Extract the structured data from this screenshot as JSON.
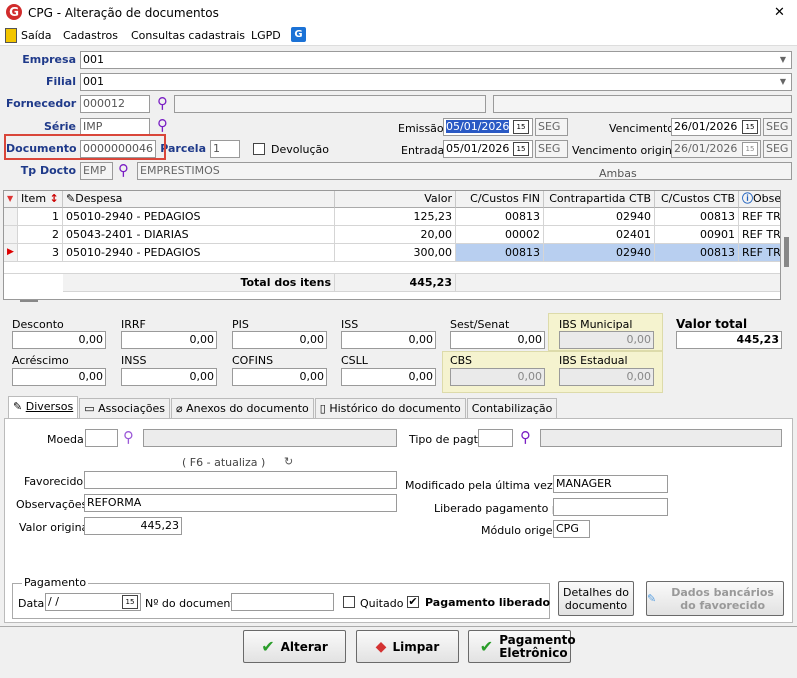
{
  "window": {
    "title": "CPG - Alteração de documentos",
    "close_glyph": "✕"
  },
  "menu": {
    "items": [
      "Saída",
      "Cadastros",
      "Consultas cadastrais",
      "LGPD"
    ]
  },
  "header": {
    "empresa_label": "Empresa",
    "empresa_value": "001",
    "filial_label": "Filial",
    "filial_value": "001",
    "fornecedor_label": "Fornecedor",
    "fornecedor_value": "000012",
    "serie_label": "Série",
    "serie_value": "IMP",
    "documento_label": "Documento",
    "documento_value": "0000000046",
    "parcela_label": "Parcela",
    "parcela_value": "1",
    "devolucao_label": "Devolução",
    "tpdocto_label": "Tp Docto",
    "tpdocto_code": "EMP",
    "tpdocto_desc": "EMPRESTIMOS",
    "emissao_label": "Emissão",
    "emissao_value": "05/01/2026",
    "emissao_day": "SEG",
    "entrada_label": "Entrada",
    "entrada_value": "05/01/2026",
    "entrada_day": "SEG",
    "vencimento_label": "Vencimento",
    "vencimento_value": "26/01/2026",
    "vencimento_day": "SEG",
    "venc_original_label": "Vencimento original",
    "venc_original_value": "26/01/2026",
    "venc_original_day": "SEG",
    "ambas_label": "Ambas",
    "cal_glyph": "15"
  },
  "items_grid": {
    "columns": [
      "Item",
      "Despesa",
      "Valor",
      "C/Custos FIN",
      "Contrapartida CTB",
      "C/Custos CTB",
      "Obse"
    ],
    "rows": [
      {
        "item": "1",
        "despesa": "05010-2940 - PEDAGIOS",
        "valor": "125,23",
        "cc_fin": "00813",
        "contrapartida": "02940",
        "cc_ctb": "00813",
        "obs": "REF TRI"
      },
      {
        "item": "2",
        "despesa": "05043-2401 - DIARIAS",
        "valor": "20,00",
        "cc_fin": "00002",
        "contrapartida": "02401",
        "cc_ctb": "00901",
        "obs": "REF TRI"
      },
      {
        "item": "3",
        "despesa": "05010-2940 - PEDAGIOS",
        "valor": "300,00",
        "cc_fin": "00813",
        "contrapartida": "02940",
        "cc_ctb": "00813",
        "obs": "REF TRI"
      }
    ],
    "total_label": "Total dos itens",
    "total_value": "445,23"
  },
  "taxes": {
    "desconto_label": "Desconto",
    "desconto": "0,00",
    "irrf_label": "IRRF",
    "irrf": "0,00",
    "pis_label": "PIS",
    "pis": "0,00",
    "iss_label": "ISS",
    "iss": "0,00",
    "sest_label": "Sest/Senat",
    "sest": "0,00",
    "ibs_mun_label": "IBS Municipal",
    "ibs_mun": "0,00",
    "valor_total_label": "Valor total",
    "valor_total": "445,23",
    "acrescimo_label": "Acréscimo",
    "acrescimo": "0,00",
    "inss_label": "INSS",
    "inss": "0,00",
    "cofins_label": "COFINS",
    "cofins": "0,00",
    "csll_label": "CSLL",
    "csll": "0,00",
    "cbs_label": "CBS",
    "cbs": "0,00",
    "ibs_est_label": "IBS Estadual",
    "ibs_est": "0,00"
  },
  "tabs": [
    "Diversos",
    "Associações",
    "Anexos do documento",
    "Histórico do documento",
    "Contabilização"
  ],
  "diversos": {
    "moeda_label": "Moeda",
    "f6_hint": "( F6 - atualiza )",
    "favorecido_label": "Favorecido",
    "observacoes_label": "Observações",
    "observacoes_value": "REFORMA",
    "valor_original_label": "Valor original",
    "valor_original_value": "445,23",
    "tipo_pagto_label": "Tipo de pagto",
    "modificado_label": "Modificado pela última vez por",
    "modificado_value": "MANAGER",
    "liberado_label": "Liberado pagamento por",
    "modulo_label": "Módulo origem",
    "modulo_value": "CPG"
  },
  "pagamento": {
    "group_label": "Pagamento",
    "data_label": "Data",
    "data_value": " /  /",
    "ndoc_label": "Nº do documento",
    "quitado_label": "Quitado",
    "liberado_label": "Pagamento liberado",
    "detalhes_label": "Detalhes do documento",
    "dados_bancarios_label": "Dados bancários do favorecido"
  },
  "footer": {
    "alterar": "Alterar",
    "limpar": "Limpar",
    "pagamento_eletronico": "Pagamento Eletrônico"
  },
  "colors": {
    "label_blue": "#1f3a8a",
    "highlight_red": "#d9463a",
    "selected_row": "#b8cff0",
    "search_purple": "#7a1fc4"
  }
}
